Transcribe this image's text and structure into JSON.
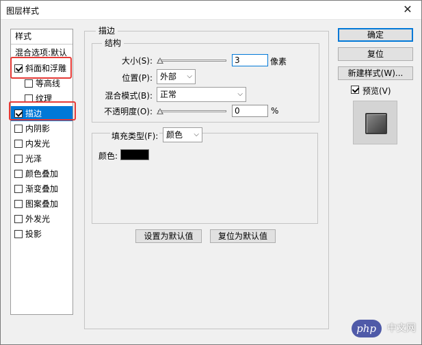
{
  "window": {
    "title": "图层样式",
    "close_glyph": "✕"
  },
  "style_list": {
    "header": "样式",
    "items": [
      {
        "label": "混合选项:默认",
        "checkbox": false,
        "checked": false
      },
      {
        "label": "斜面和浮雕",
        "checkbox": true,
        "checked": true
      },
      {
        "label": "等高线",
        "checkbox": true,
        "checked": false
      },
      {
        "label": "纹理",
        "checkbox": true,
        "checked": false
      },
      {
        "label": "描边",
        "checkbox": true,
        "checked": true,
        "selected": true
      },
      {
        "label": "内阴影",
        "checkbox": true,
        "checked": false
      },
      {
        "label": "内发光",
        "checkbox": true,
        "checked": false
      },
      {
        "label": "光泽",
        "checkbox": true,
        "checked": false
      },
      {
        "label": "颜色叠加",
        "checkbox": true,
        "checked": false
      },
      {
        "label": "渐变叠加",
        "checkbox": true,
        "checked": false
      },
      {
        "label": "图案叠加",
        "checkbox": true,
        "checked": false
      },
      {
        "label": "外发光",
        "checkbox": true,
        "checked": false
      },
      {
        "label": "投影",
        "checkbox": true,
        "checked": false
      }
    ]
  },
  "stroke": {
    "title": "描边",
    "structure": {
      "title": "结构",
      "size_label": "大小(S):",
      "size_value": "3",
      "size_unit": "像素",
      "position_label": "位置(P):",
      "position_value": "外部",
      "blend_label": "混合模式(B):",
      "blend_value": "正常",
      "opacity_label": "不透明度(O):",
      "opacity_value": "0",
      "opacity_unit": "%"
    },
    "fill": {
      "type_label": "填充类型(F):",
      "type_value": "颜色",
      "color_label": "颜色:",
      "color": "#000000"
    },
    "make_default": "设置为默认值",
    "reset_default": "复位为默认值"
  },
  "buttons": {
    "ok": "确定",
    "reset": "复位",
    "new_style": "新建样式(W)...",
    "preview_label": "预览(V)",
    "preview_checked": true
  },
  "watermark": {
    "logo": "php",
    "text": "中文网"
  },
  "colors": {
    "selection": "#0078d7",
    "highlight": "#e53935"
  }
}
